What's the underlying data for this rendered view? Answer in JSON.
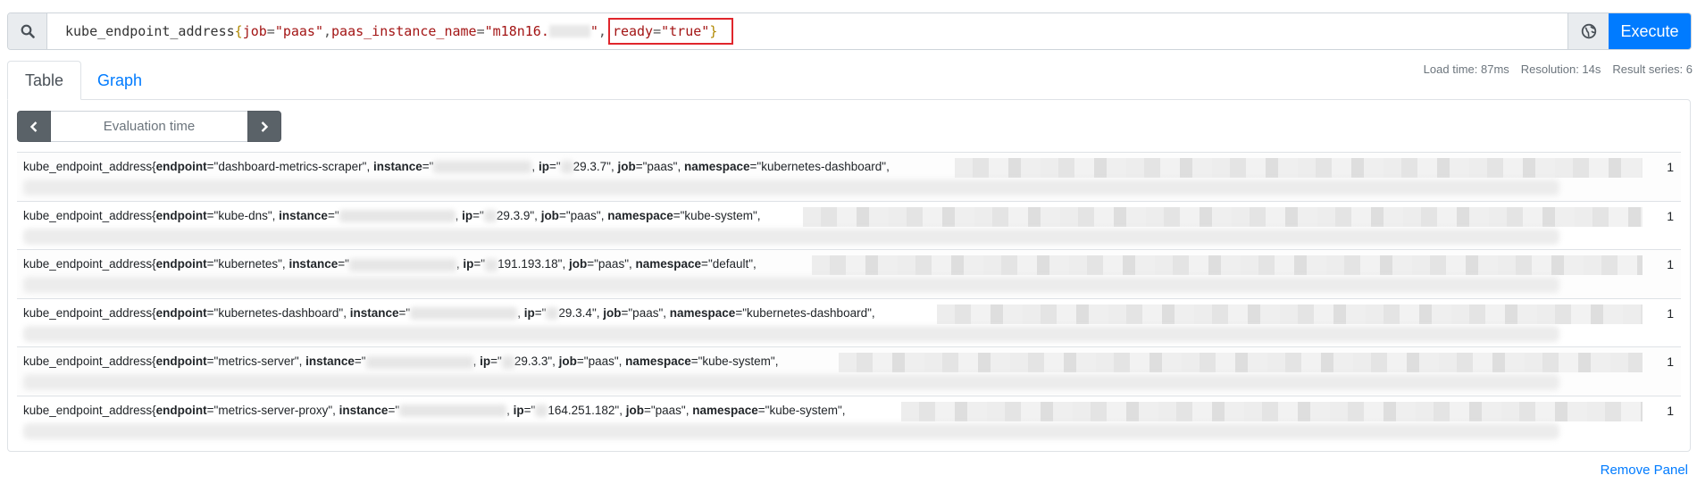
{
  "query": {
    "metric": "kube_endpoint_address",
    "open_brace": "{",
    "close_brace": "}",
    "label1_name": "job",
    "label1_value": "\"paas\"",
    "label2_name": "paas_instance_name",
    "label2_value_prefix": "\"m18n16.",
    "label3_name": "ready",
    "label3_value": "\"true\"",
    "sep": ", ",
    "eq": "="
  },
  "execute_label": "Execute",
  "tabs": {
    "table": "Table",
    "graph": "Graph"
  },
  "stats": {
    "load_time": "Load time: 87ms",
    "resolution": "Resolution: 14s",
    "result_series": "Result series: 6"
  },
  "eval": {
    "placeholder": "Evaluation time"
  },
  "results": [
    {
      "metric": "kube_endpoint_address{",
      "endpoint": "\"dashboard-metrics-scraper\"",
      "ip": "29.3.7\"",
      "job": "\"paas\"",
      "namespace": "\"kubernetes-dashboard\",",
      "value": "1"
    },
    {
      "metric": "kube_endpoint_address{",
      "endpoint": "\"kube-dns\"",
      "ip": "29.3.9\"",
      "job": "\"paas\"",
      "namespace": "\"kube-system\",",
      "value": "1"
    },
    {
      "metric": "kube_endpoint_address{",
      "endpoint": "\"kubernetes\"",
      "ip": "191.193.18\"",
      "job": "\"paas\"",
      "namespace": "\"default\",",
      "value": "1"
    },
    {
      "metric": "kube_endpoint_address{",
      "endpoint": "\"kubernetes-dashboard\"",
      "ip": "29.3.4\"",
      "job": "\"paas\"",
      "namespace": "\"kubernetes-dashboard\",",
      "value": "1"
    },
    {
      "metric": "kube_endpoint_address{",
      "endpoint": "\"metrics-server\"",
      "ip": "29.3.3\"",
      "job": "\"paas\"",
      "namespace": "\"kube-system\",",
      "value": "1"
    },
    {
      "metric": "kube_endpoint_address{",
      "endpoint": "\"metrics-server-proxy\"",
      "ip": "164.251.182\"",
      "job": "\"paas\"",
      "namespace": "\"kube-system\",",
      "value": "1"
    }
  ],
  "row_labels": {
    "endpoint": "endpoint",
    "instance": "instance",
    "ip": "ip",
    "job": "job",
    "namespace": "namespace",
    "eq": "=",
    "instance_open": "=\"",
    "ip_open": "=\"",
    "comma": ", "
  },
  "remove_panel": "Remove Panel",
  "colors": {
    "accent": "#007bff",
    "highlight_border": "#e0262c",
    "string_literal": "#a31515",
    "brace": "#b08800"
  },
  "icons": {
    "search": "search-icon",
    "explorer": "globe-icon",
    "prev": "chevron-left-icon",
    "next": "chevron-right-icon"
  }
}
